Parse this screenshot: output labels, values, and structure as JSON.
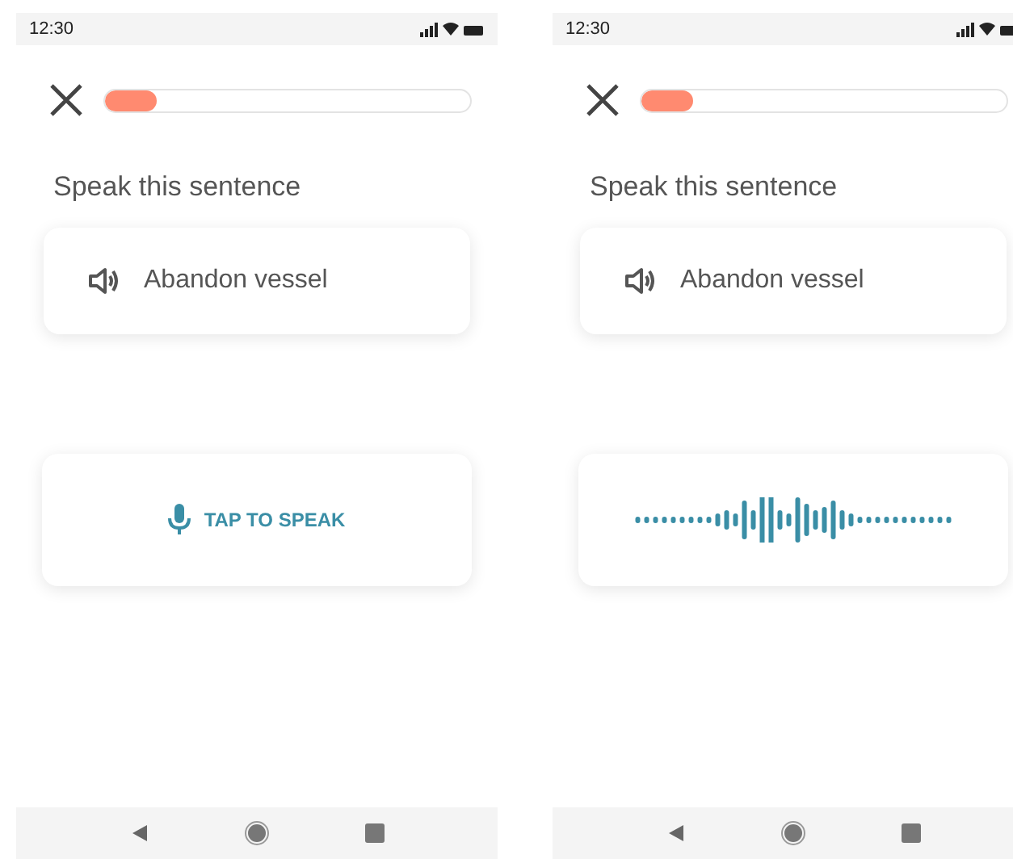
{
  "screens": [
    {
      "status_bar": {
        "time": "12:30"
      },
      "progress": {
        "level": 0.14
      },
      "prompt": "Speak this sentence",
      "sentence": "Abandon vessel",
      "speak_panel": {
        "kind": "button",
        "label": "TAP TO SPEAK"
      }
    },
    {
      "status_bar": {
        "time": "12:30"
      },
      "progress": {
        "level": 0.14
      },
      "prompt": "Speak this sentence",
      "sentence": "Abandon vessel",
      "speak_panel": {
        "kind": "waveform"
      }
    }
  ]
}
